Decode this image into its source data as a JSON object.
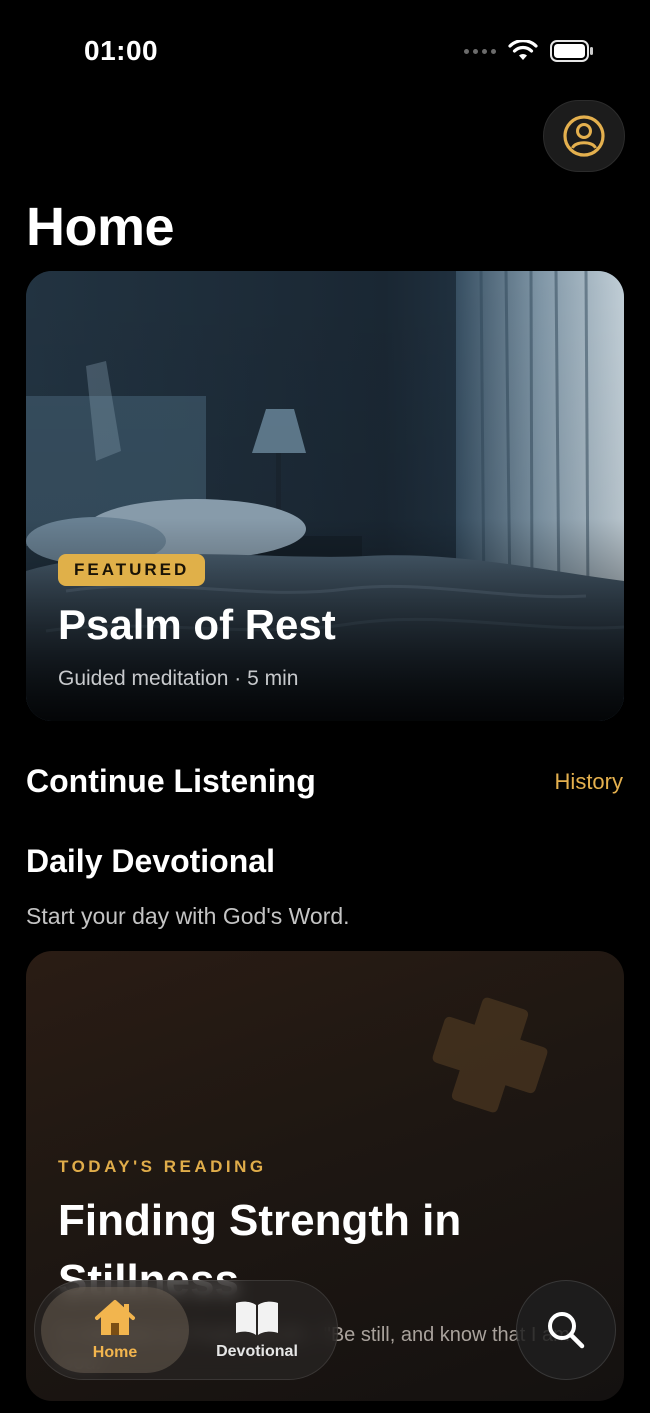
{
  "status_bar": {
    "time": "01:00"
  },
  "header": {
    "title": "Home",
    "profile_icon": "person-circle-icon"
  },
  "featured": {
    "badge": "FEATURED",
    "title": "Psalm of Rest",
    "subtitle": "Guided meditation · 5 min",
    "image": "dim-bedroom-photo"
  },
  "continue_listening": {
    "title": "Continue Listening",
    "link": "History"
  },
  "daily_devotional": {
    "title": "Daily Devotional",
    "subtitle": "Start your day with God's Word.",
    "card": {
      "label": "TODAY'S READING",
      "title": "Finding Strength in Stillness",
      "excerpt": "A reflection on Psalm 46:10 – \"Be still, and know that I am God.\""
    }
  },
  "tab_bar": {
    "tabs": [
      {
        "label": "Home",
        "icon": "house-icon",
        "active": true
      },
      {
        "label": "Devotional",
        "icon": "book-icon",
        "active": false
      }
    ],
    "search_icon": "search-icon"
  },
  "colors": {
    "accent": "#E4B04E",
    "background": "#000000",
    "badge": "#E0B049"
  }
}
